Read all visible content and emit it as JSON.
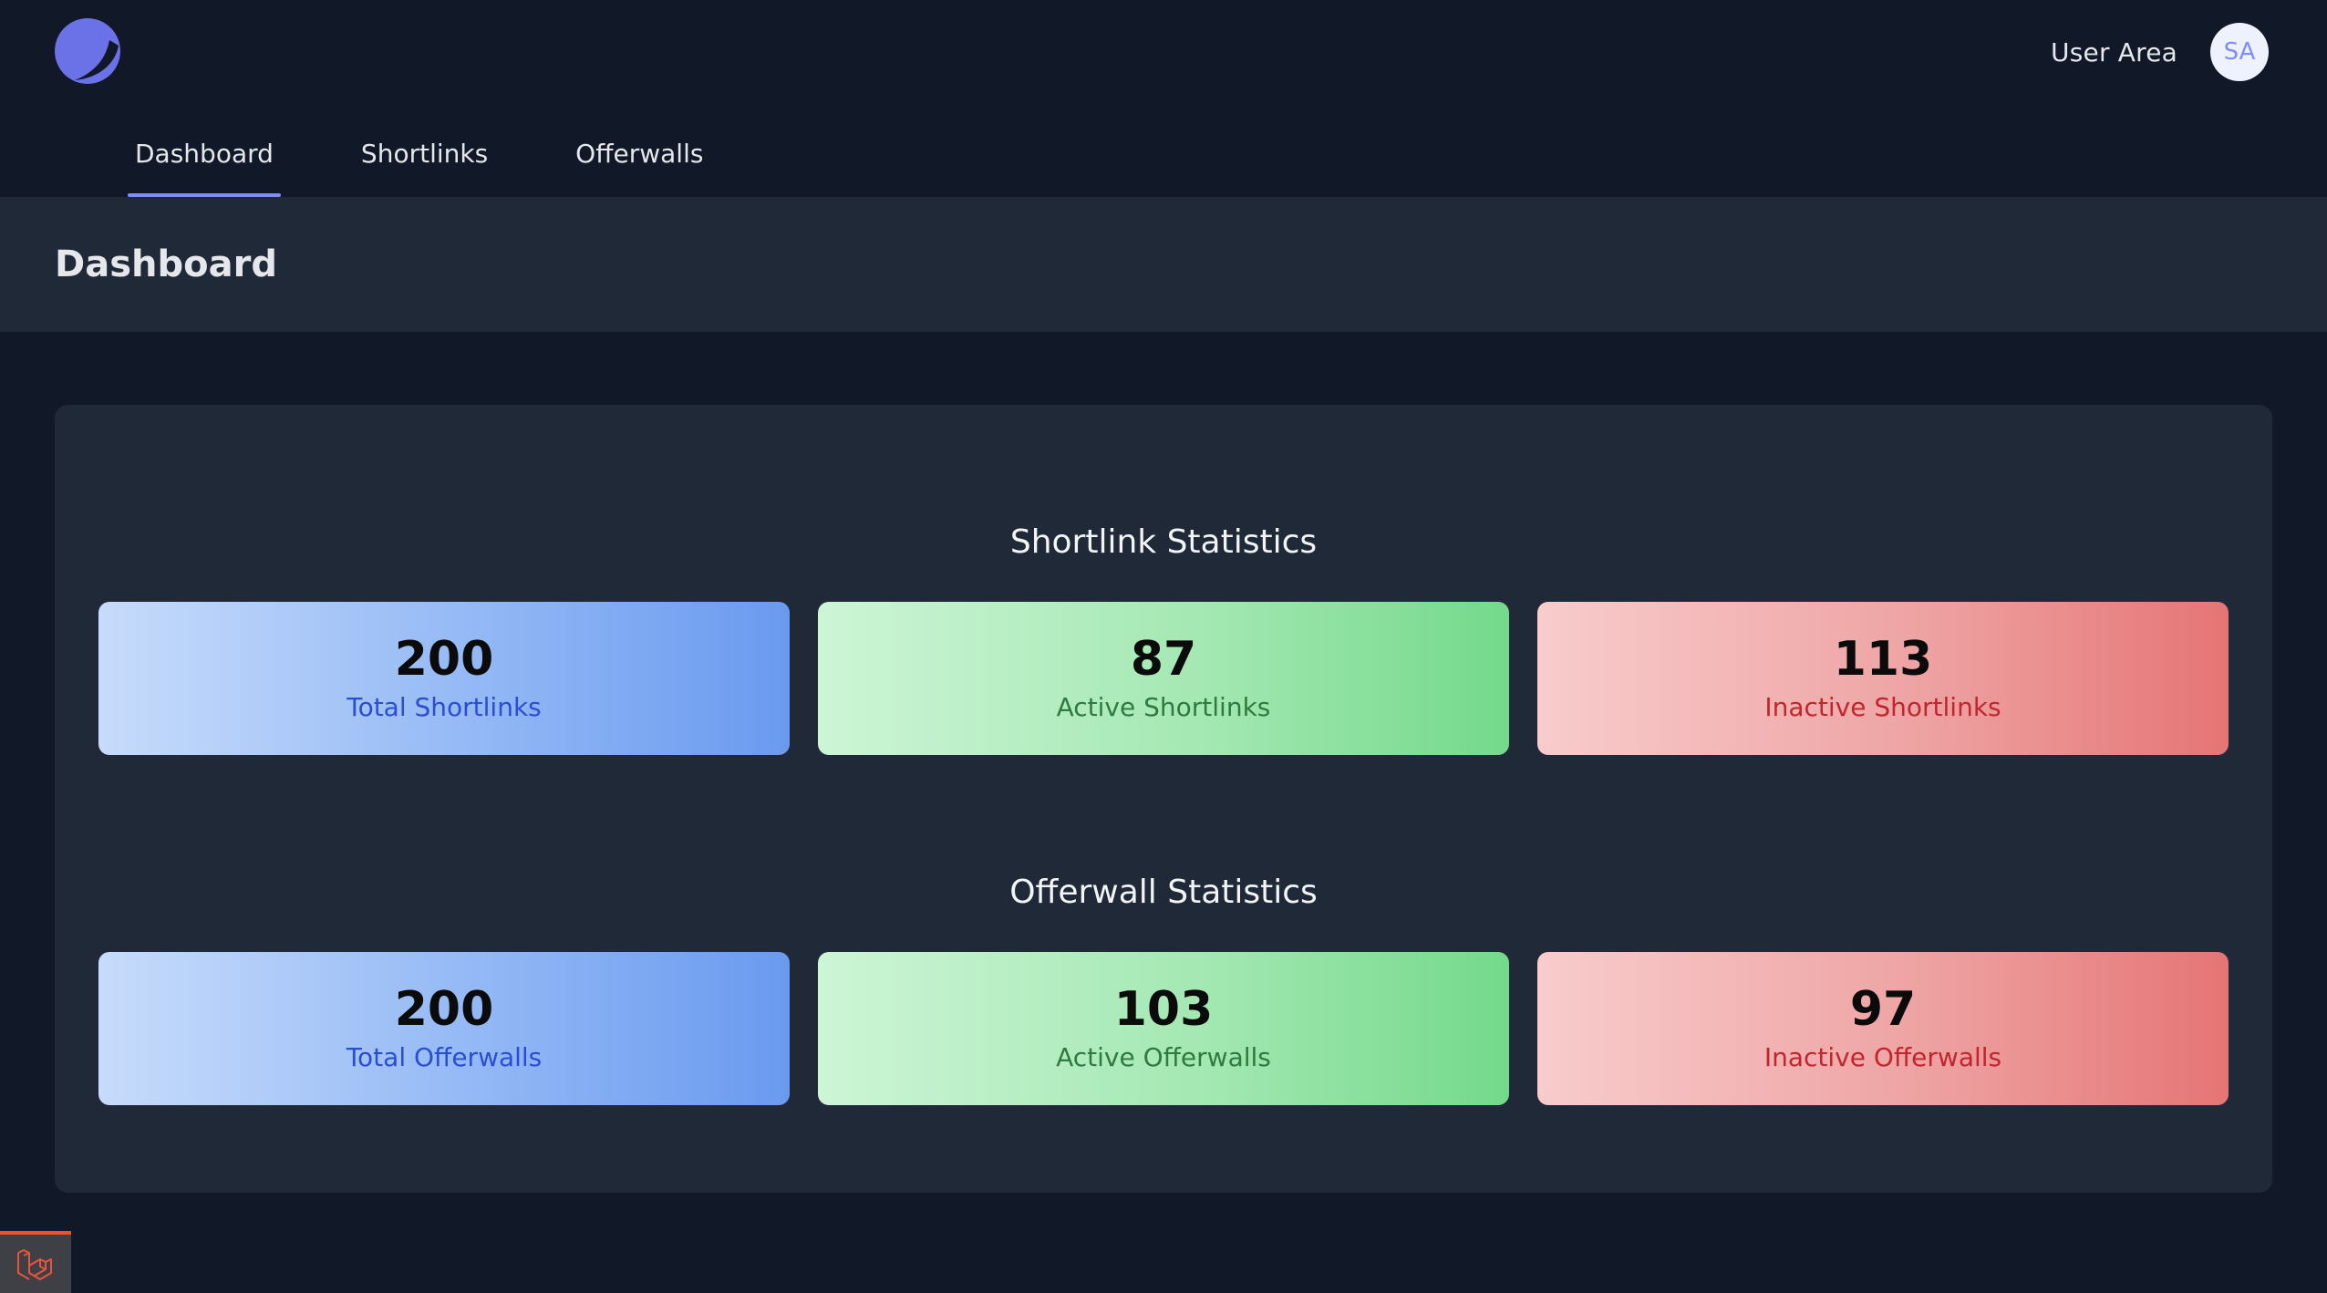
{
  "header": {
    "user_area_label": "User Area",
    "avatar_initials": "SA",
    "accent_color": "#818cf8"
  },
  "nav": {
    "tabs": [
      {
        "label": "Dashboard",
        "active": true
      },
      {
        "label": "Shortlinks",
        "active": false
      },
      {
        "label": "Offerwalls",
        "active": false
      }
    ]
  },
  "page": {
    "title": "Dashboard"
  },
  "shortlink_stats": {
    "title": "Shortlink Statistics",
    "cards": [
      {
        "value": "200",
        "label": "Total Shortlinks",
        "color": "blue"
      },
      {
        "value": "87",
        "label": "Active Shortlinks",
        "color": "green"
      },
      {
        "value": "113",
        "label": "Inactive Shortlinks",
        "color": "red"
      }
    ]
  },
  "offerwall_stats": {
    "title": "Offerwall Statistics",
    "cards": [
      {
        "value": "200",
        "label": "Total Offerwalls",
        "color": "blue"
      },
      {
        "value": "103",
        "label": "Active Offerwalls",
        "color": "green"
      },
      {
        "value": "97",
        "label": "Inactive Offerwalls",
        "color": "red"
      }
    ]
  },
  "icons": {
    "logo": "crescent-logo-icon",
    "debug": "laravel-icon"
  }
}
